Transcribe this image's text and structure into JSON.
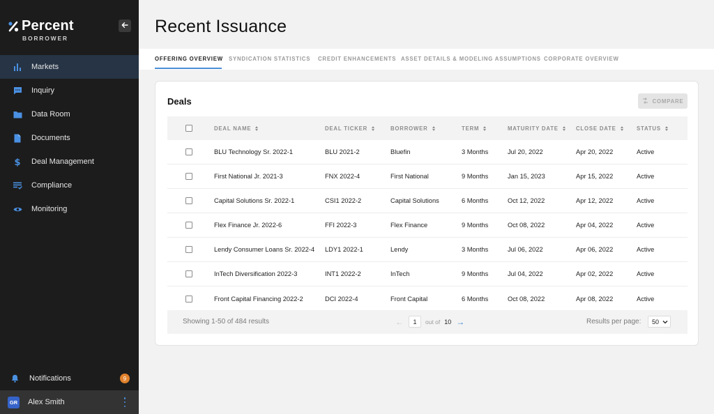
{
  "sidebar": {
    "brand": "Percent",
    "brand_sub": "BORROWER",
    "items": [
      {
        "label": "Markets",
        "icon": "bar-chart-icon",
        "active": true
      },
      {
        "label": "Inquiry",
        "icon": "chat-icon"
      },
      {
        "label": "Data Room",
        "icon": "folder-icon"
      },
      {
        "label": "Documents",
        "icon": "document-icon"
      },
      {
        "label": "Deal Management",
        "icon": "dollar-icon"
      },
      {
        "label": "Compliance",
        "icon": "checklist-icon"
      },
      {
        "label": "Monitoring",
        "icon": "eye-icon"
      }
    ],
    "notifications": {
      "label": "Notifications",
      "count": "9"
    },
    "user": {
      "initials": "GR",
      "name": "Alex Smith"
    }
  },
  "header": {
    "title": "Recent Issuance"
  },
  "tabs": [
    {
      "label": "OFFERING OVERVIEW",
      "active": true
    },
    {
      "label": "SYNDICATION STATISTICS"
    },
    {
      "label": "CREDIT ENHANCEMENTS"
    },
    {
      "label": "ASSET DETAILS & MODELING ASSUMPTIONS"
    },
    {
      "label": "CORPORATE OVERVIEW"
    }
  ],
  "deals": {
    "title": "Deals",
    "compare_label": "COMPARE",
    "columns": [
      "DEAL NAME",
      "DEAL TICKER",
      "BORROWER",
      "TERM",
      "MATURITY DATE",
      "CLOSE DATE",
      "STATUS"
    ],
    "rows": [
      [
        "BLU Technology Sr. 2022-1",
        "BLU 2021-2",
        "Bluefin",
        "3 Months",
        "Jul 20, 2022",
        "Apr 20, 2022",
        "Active"
      ],
      [
        "First National Jr. 2021-3",
        "FNX 2022-4",
        "First National",
        "9 Months",
        "Jan 15, 2023",
        "Apr 15, 2022",
        "Active"
      ],
      [
        "Capital Solutions Sr. 2022-1",
        "CSI1 2022-2",
        "Capital Solutions",
        "6 Months",
        "Oct 12, 2022",
        "Apr 12, 2022",
        "Active"
      ],
      [
        "Flex Finance Jr. 2022-6",
        "FFI 2022-3",
        "Flex Finance",
        "9 Months",
        "Oct 08, 2022",
        "Apr 04, 2022",
        "Active"
      ],
      [
        "Lendy Consumer Loans Sr. 2022-4",
        "LDY1 2022-1",
        "Lendy",
        "3 Months",
        "Jul 06, 2022",
        "Apr 06, 2022",
        "Active"
      ],
      [
        "InTech Diversification 2022-3",
        "INT1 2022-2",
        "InTech",
        "9 Months",
        "Jul 04, 2022",
        "Apr 02, 2022",
        "Active"
      ],
      [
        "Front Capital Financing 2022-2",
        "DCI 2022-4",
        "Front Capital",
        "6 Months",
        "Oct 08, 2022",
        "Apr 08, 2022",
        "Active"
      ]
    ],
    "footer": {
      "showing": "Showing 1-50 of 484 results",
      "page": "1",
      "out_of": "out of",
      "total_pages": "10",
      "rpp_label": "Results per page:",
      "rpp_value": "50"
    }
  },
  "colors": {
    "sidebar_bg": "#1c1c1c",
    "active_nav": "#263445",
    "accent": "#4a8fd8",
    "badge": "#e0822d"
  }
}
